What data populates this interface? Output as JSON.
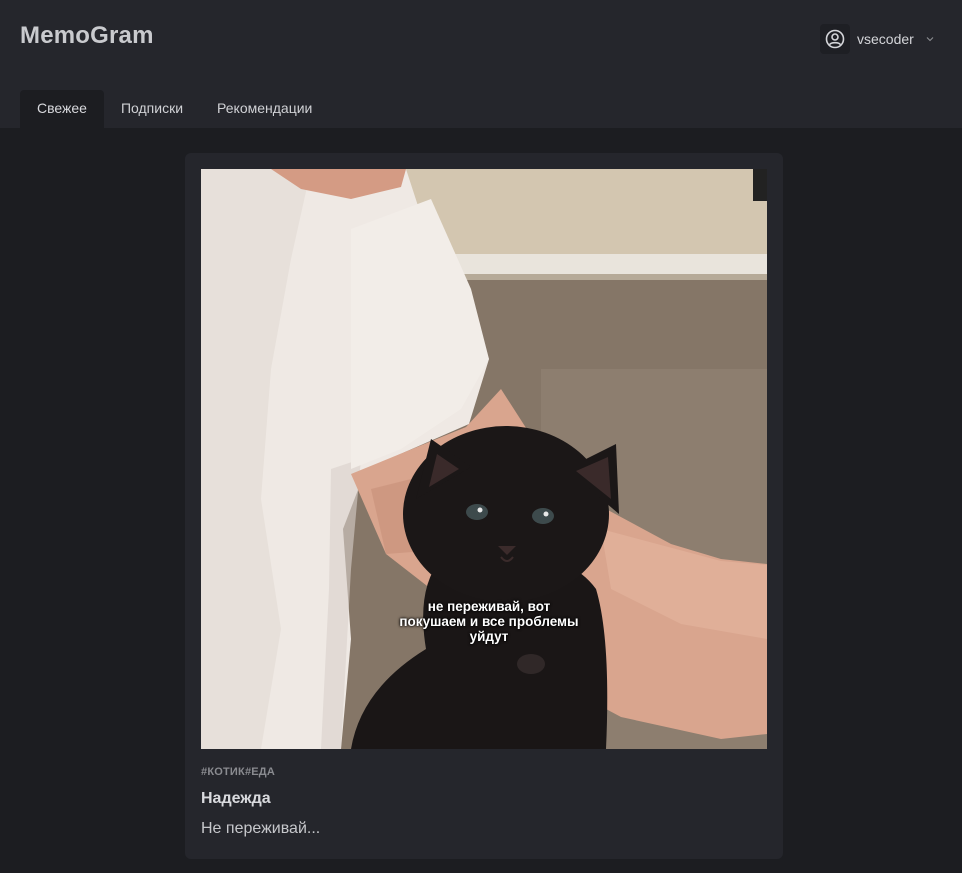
{
  "app": {
    "logo": "MemoGram"
  },
  "user": {
    "name": "vsecoder",
    "icon": "user-circle-icon",
    "menu_icon": "chevron-down-icon"
  },
  "tabs": [
    {
      "label": "Свежее",
      "active": true
    },
    {
      "label": "Подписки",
      "active": false
    },
    {
      "label": "Рекомендации",
      "active": false
    }
  ],
  "post": {
    "image_caption": "не переживай, вот покушаем и все проблемы уйдут",
    "tags": [
      "#КОТИК",
      "#ЕДА"
    ],
    "title": "Надежда",
    "excerpt": "Не переживай..."
  },
  "colors": {
    "page_background": "#1c1d21",
    "header_background": "#25262c",
    "card_background": "#25262c",
    "tag_text": "#8a8b90"
  }
}
